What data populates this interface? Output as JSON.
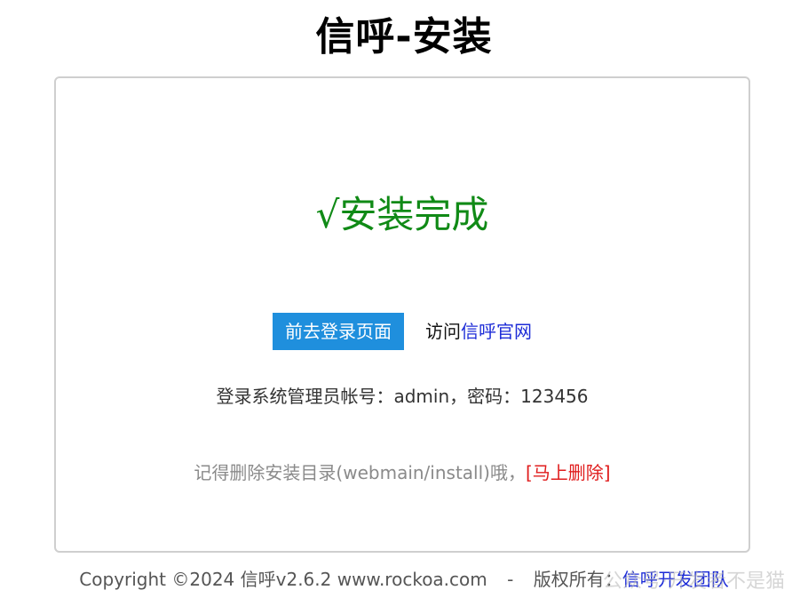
{
  "header": {
    "title": "信呼-安装"
  },
  "main": {
    "success_text": "√安装完成",
    "login_button_label": "前去登录页面",
    "visit_prefix": "访问",
    "visit_link_label": "信呼官网",
    "account_info": "登录系统管理员帐号：admin，密码：123456",
    "notice_text": "记得删除安装目录(webmain/install)哦，",
    "delete_link_label": "[马上删除]"
  },
  "footer": {
    "copyright": "Copyright ©2024 信呼v2.6.2 www.rockoa.com",
    "separator": "-",
    "rights_label": "版权所有：",
    "team_link_label": "信呼开发团队"
  },
  "watermark": {
    "text": "公众号·开发者不是猫"
  },
  "colors": {
    "success": "#108a16",
    "primary_button": "#1f8fdd",
    "link": "#1c2bd7",
    "danger": "#e01d1d"
  }
}
